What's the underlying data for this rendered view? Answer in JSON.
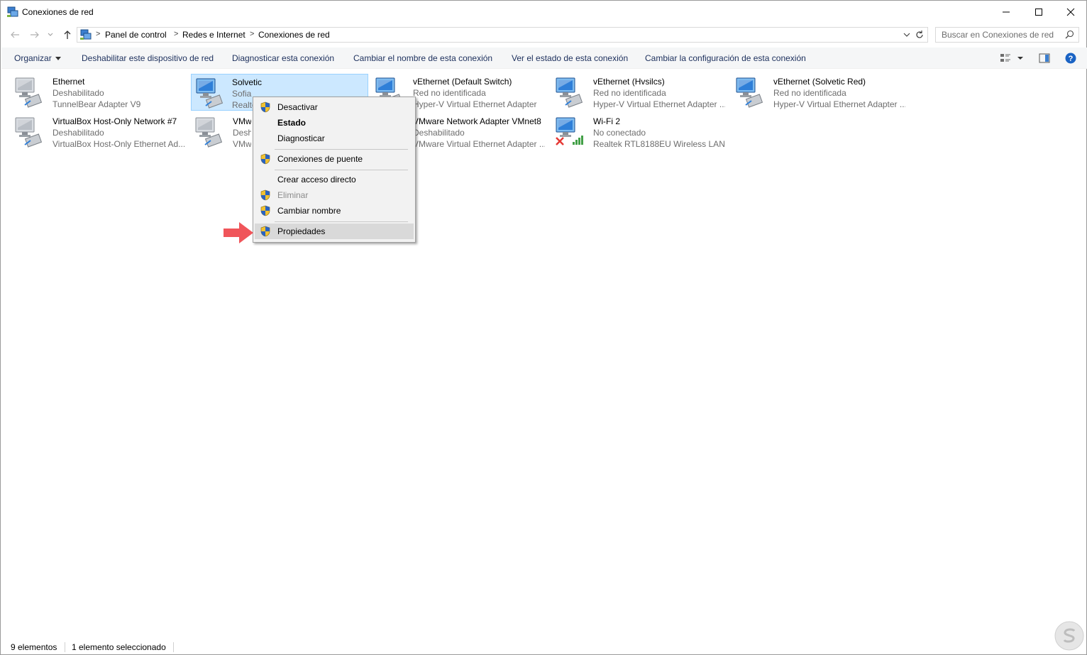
{
  "window": {
    "title": "Conexiones de red"
  },
  "address": {
    "crumbs": [
      "Panel de control",
      "Redes e Internet",
      "Conexiones de red"
    ],
    "separator": ">"
  },
  "search": {
    "placeholder": "Buscar en Conexiones de red"
  },
  "commandbar": {
    "organize": "Organizar",
    "disable": "Deshabilitar este dispositivo de red",
    "diagnose": "Diagnosticar esta conexión",
    "rename": "Cambiar el nombre de esta conexión",
    "view_status": "Ver el estado de esta conexión",
    "change_settings": "Cambiar la configuración de esta conexión"
  },
  "connections": [
    {
      "name": "Ethernet",
      "status": "Deshabilitado",
      "device": "TunnelBear Adapter V9",
      "icon": "network-adapter-disabled-icon"
    },
    {
      "name": "Solvetic",
      "status": "Sofia",
      "device": "Realtek PCIe GBE Family Controller",
      "icon": "network-adapter-icon",
      "selected": true
    },
    {
      "name": "vEthernet (Default Switch)",
      "status": "Red no identificada",
      "device": "Hyper-V Virtual Ethernet Adapter",
      "icon": "network-adapter-icon"
    },
    {
      "name": "vEthernet (Hvsilcs)",
      "status": "Red no identificada",
      "device": "Hyper-V Virtual Ethernet Adapter ...",
      "icon": "network-adapter-icon"
    },
    {
      "name": "vEthernet (Solvetic Red)",
      "status": "Red no identificada",
      "device": "Hyper-V Virtual Ethernet Adapter ...",
      "icon": "network-adapter-icon"
    },
    {
      "name": "VirtualBox Host-Only Network #7",
      "status": "Deshabilitado",
      "device": "VirtualBox Host-Only Ethernet Ad...",
      "icon": "network-adapter-disabled-icon"
    },
    {
      "name": "VMware Network Adapter VMnet1",
      "status": "Deshabilitado",
      "device": "VMware Virtual Ethernet Adapter ...",
      "icon": "network-adapter-disabled-icon"
    },
    {
      "name": "VMware Network Adapter VMnet8",
      "status": "Deshabilitado",
      "device": "VMware Virtual Ethernet Adapter ...",
      "icon": "network-adapter-disabled-icon"
    },
    {
      "name": "Wi-Fi 2",
      "status": "No conectado",
      "device": "Realtek RTL8188EU Wireless LAN ...",
      "icon": "wifi-adapter-disconnected-icon"
    }
  ],
  "context_menu": {
    "items": [
      {
        "label": "Desactivar",
        "shield": true
      },
      {
        "label": "Estado",
        "bold": true
      },
      {
        "label": "Diagnosticar"
      },
      {
        "label": "Conexiones de puente",
        "shield": true
      },
      {
        "label": "Crear acceso directo"
      },
      {
        "label": "Eliminar",
        "shield": true,
        "disabled": true
      },
      {
        "label": "Cambiar nombre",
        "shield": true
      },
      {
        "label": "Propiedades",
        "shield": true,
        "highlighted": true
      }
    ]
  },
  "statusbar": {
    "count": "9 elementos",
    "selected": "1 elemento seleccionado"
  },
  "colors": {
    "selection_bg": "#cce8ff",
    "selection_border": "#99d1ff",
    "menu_bg": "#f2f2f2",
    "menu_hover": "#d9d9d9",
    "pointer_arrow": "#f0555a",
    "link_text": "#1c2f5c"
  }
}
